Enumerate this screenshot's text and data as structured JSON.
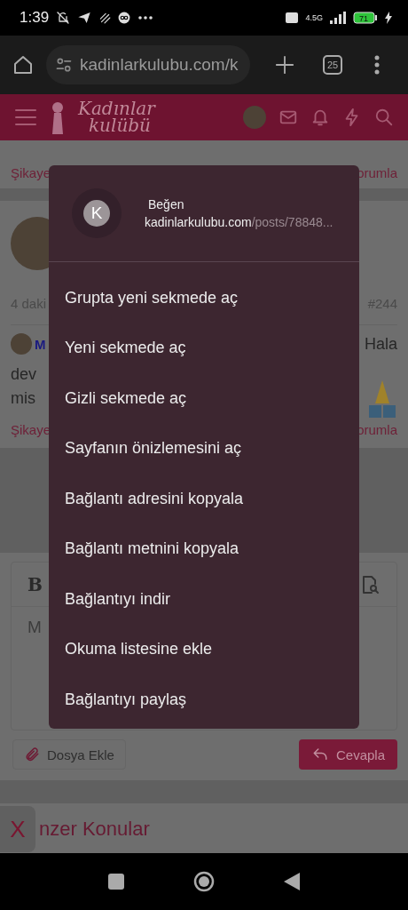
{
  "status_bar": {
    "time": "1:39",
    "network": "4.5G",
    "battery": "71"
  },
  "browser": {
    "url": "kadinlarkulubu.com/k",
    "tab_count": "25"
  },
  "site_header": {
    "logo_top": "Kadınlar",
    "logo_bottom": "kulübü"
  },
  "page": {
    "post_actions_1": {
      "left": "Şikaye",
      "right": "orumla"
    },
    "post_meta": {
      "time": "4 daki",
      "number": "#244"
    },
    "quote": {
      "author": "M",
      "tail": "Hala"
    },
    "body_lines": [
      "dev",
      "mis"
    ],
    "post_actions_2": {
      "left": "Şikaye",
      "right": "orumla"
    },
    "editor": {
      "bold_label": "B",
      "placeholder": "M"
    },
    "attach_button": "Dosya Ekle",
    "reply_button": "Cevapla",
    "similar_heading": "nzer Konular",
    "close_float": "X"
  },
  "context_menu": {
    "avatar_letter": "K",
    "title": "Beğen",
    "url_host": "kadinlarkulubu.com",
    "url_path": "/posts/78848...",
    "items": [
      "Grupta yeni sekmede aç",
      "Yeni sekmede aç",
      "Gizli sekmede aç",
      "Sayfanın önizlemesini aç",
      "Bağlantı adresini kopyala",
      "Bağlantı metnini kopyala",
      "Bağlantıyı indir",
      "Okuma listesine ekle",
      "Bağlantıyı paylaş"
    ]
  }
}
